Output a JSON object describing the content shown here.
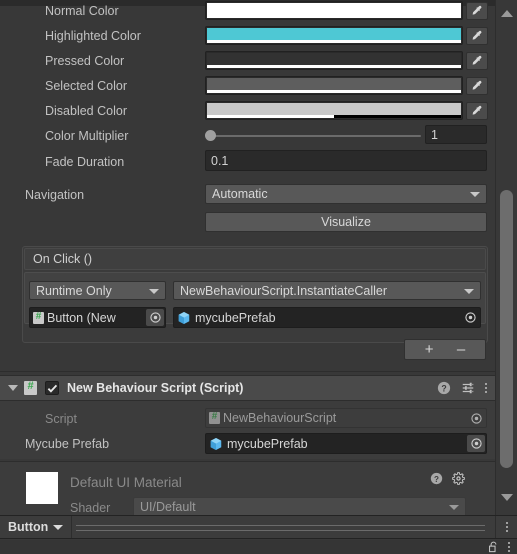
{
  "app": {
    "name": "unity-inspector"
  },
  "colors": {
    "panel_bg": "#383838",
    "header_bg": "#4a4a4a",
    "field_bg": "#2a2a2a",
    "dropdown_bg": "#585858",
    "accent_highlight": "#4ec8d4",
    "text": "#c2c2c2",
    "text_dim": "#8a8a8a"
  },
  "color_block": {
    "rows": [
      {
        "label": "Normal Color",
        "swatch": "#ffffff",
        "alpha": 100
      },
      {
        "label": "Highlighted Color",
        "swatch": "#4ec8d4",
        "alpha": 100
      },
      {
        "label": "Pressed Color",
        "swatch": "#323232",
        "alpha": 100
      },
      {
        "label": "Selected Color",
        "swatch": "#5e5e5e",
        "alpha": 100
      },
      {
        "label": "Disabled Color",
        "swatch": "#c8c8c8",
        "alpha": 50
      }
    ],
    "eyedropper_icon": "eyedropper-icon"
  },
  "color_multiplier": {
    "label": "Color Multiplier",
    "value": "1",
    "slider_percent": 0
  },
  "fade_duration": {
    "label": "Fade Duration",
    "value": "0.1"
  },
  "navigation": {
    "label": "Navigation",
    "value": "Automatic",
    "visualize_label": "Visualize"
  },
  "on_click": {
    "header": "On Click ()",
    "entry": {
      "mode": "Runtime Only",
      "function": "NewBehaviourScript.InstantiateCaller",
      "target_object": "Button (New",
      "target_icon": "script-icon",
      "argument_object": "mycubePrefab",
      "argument_icon": "prefab-cube-icon"
    },
    "add_label": "+",
    "remove_label": "–"
  },
  "script_component": {
    "title": "New Behaviour Script (Script)",
    "enabled": true,
    "icon": "script-icon",
    "foldout_icon": "foldout-open-icon",
    "help_icon": "help-icon",
    "preset_icon": "preset-icon",
    "menu_icon": "kebab-menu-icon",
    "fields": [
      {
        "label": "Script",
        "value": "NewBehaviourScript",
        "icon": "script-icon",
        "readonly": true
      },
      {
        "label": "Mycube Prefab",
        "value": "mycubePrefab",
        "icon": "prefab-cube-icon",
        "readonly": false
      }
    ]
  },
  "material_block": {
    "title": "Default UI Material",
    "swatch": "#ffffff",
    "help_icon": "help-icon",
    "settings_icon": "gear-icon",
    "shader_label": "Shader",
    "shader_value": "UI/Default"
  },
  "scrollbar": {
    "up_icon": "scroll-up-arrow-icon",
    "down_icon": "scroll-down-arrow-icon"
  },
  "breadcrumb_bar": {
    "crumb": "Button",
    "caret_icon": "chevron-down-icon",
    "menu_icon": "kebab-menu-icon"
  },
  "status_bar": {
    "lock_icon": "lock-open-icon",
    "menu_icon": "kebab-menu-icon"
  }
}
